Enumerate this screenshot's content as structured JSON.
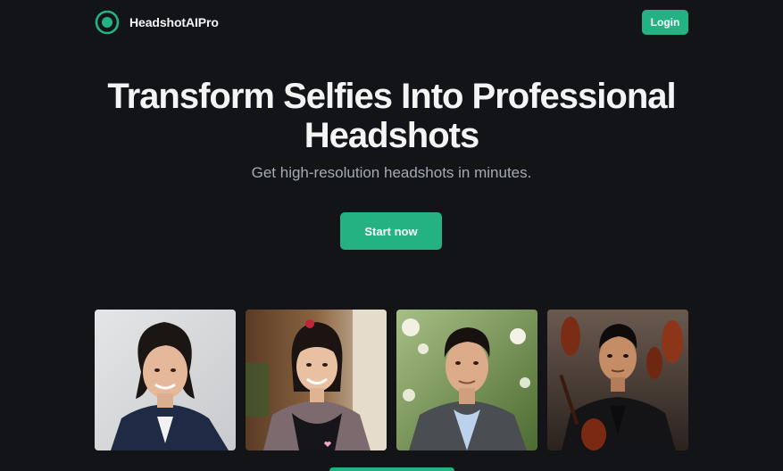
{
  "header": {
    "brand_name": "HeadshotAIPro",
    "logo_icon": "target-ring-icon",
    "login_label": "Login"
  },
  "hero": {
    "title_line1": "Transform Selfies Into Professional",
    "title_line2": "Headshots",
    "subtitle": "Get high-resolution headshots in minutes.",
    "cta_label": "Start now"
  },
  "gallery": {
    "items": [
      {
        "subject": "woman-blazer-headshot"
      },
      {
        "subject": "woman-apron-headshot"
      },
      {
        "subject": "man-garden-headshot"
      },
      {
        "subject": "man-violin-headshot"
      }
    ]
  },
  "colors": {
    "background": "#131418",
    "accent": "#25b283",
    "text_primary": "#f4f4f5",
    "text_secondary": "#a4a9b4"
  }
}
